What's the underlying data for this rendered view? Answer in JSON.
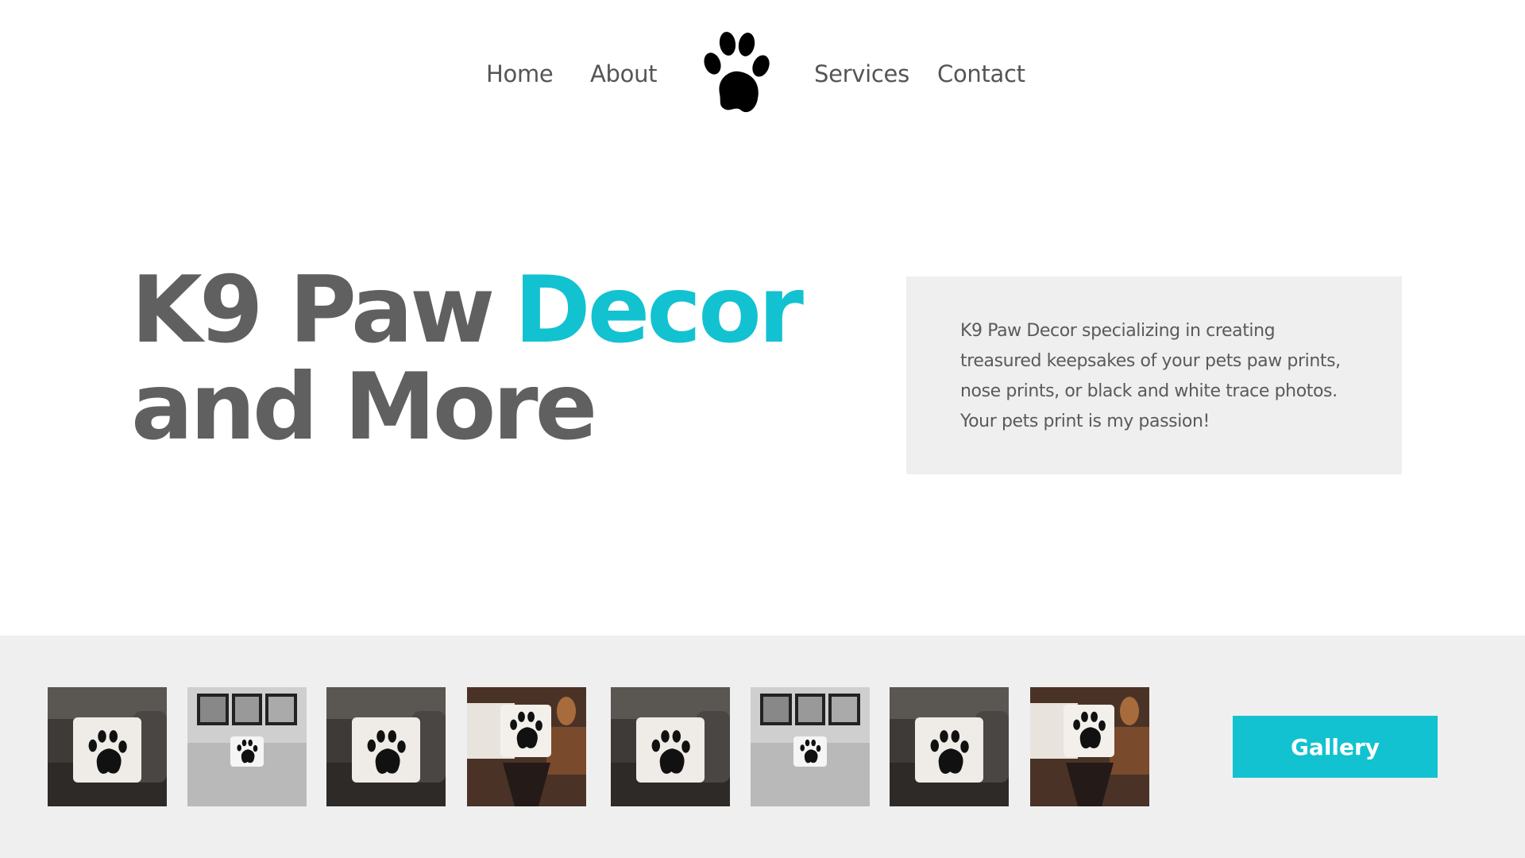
{
  "nav": {
    "home": "Home",
    "about": "About",
    "services": "Services",
    "contact": "Contact",
    "logo_icon": "paw-print-icon"
  },
  "hero": {
    "title_part1": "K9 Paw",
    "title_accent": "Decor",
    "title_line2": "and More",
    "accent_color": "#12c2d0",
    "text_color": "#606060"
  },
  "info": {
    "text": "K9 Paw Decor specializing in creating treasured keepsakes of your pets paw prints, nose prints, or black and white trace photos. Your pets print is my passion!"
  },
  "gallery": {
    "button_label": "Gallery",
    "thumbnails": [
      {
        "scene": "pillow-on-leather-couch"
      },
      {
        "scene": "pillow-on-bed-with-wall-art"
      },
      {
        "scene": "pillow-on-leather-couch"
      },
      {
        "scene": "pillow-on-side-table"
      },
      {
        "scene": "pillow-on-leather-couch"
      },
      {
        "scene": "pillow-on-bed-with-wall-art"
      },
      {
        "scene": "pillow-on-leather-couch"
      },
      {
        "scene": "pillow-on-side-table"
      }
    ]
  }
}
